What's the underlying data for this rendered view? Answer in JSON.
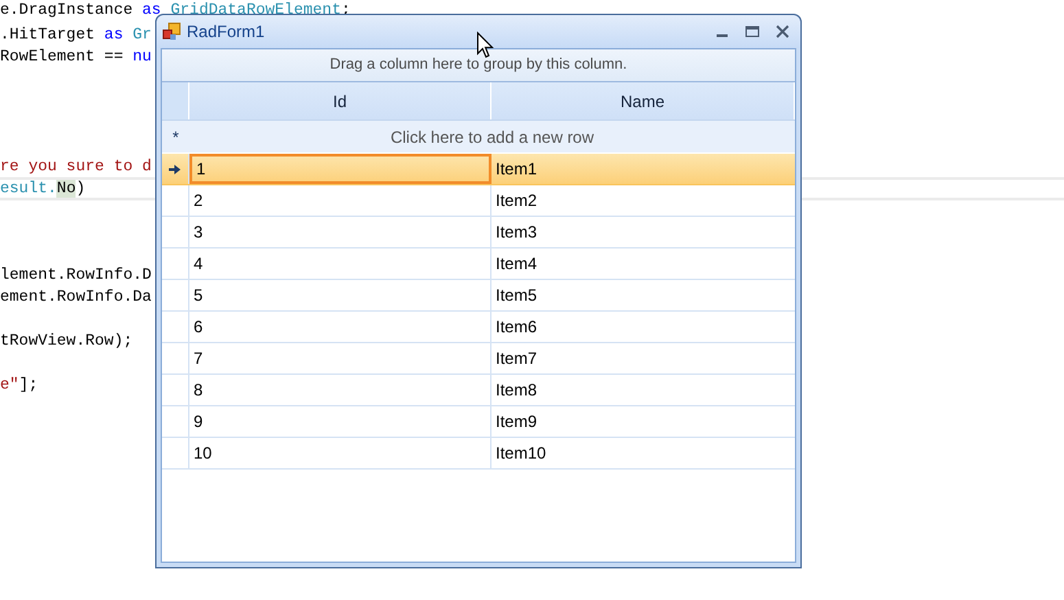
{
  "editor": {
    "lines": [
      {
        "kind": "mixed",
        "parts": [
          {
            "t": "e.DragInstance",
            "kind": "plain"
          },
          {
            "t": " as",
            "kind": "keyword"
          },
          {
            "t": " GridDataRowElement",
            "kind": "type"
          },
          {
            "t": ";",
            "kind": "plain"
          }
        ]
      },
      {
        "kind": "mixed",
        "parts": [
          {
            "t": ".HitTarget",
            "kind": "plain"
          },
          {
            "t": " as",
            "kind": "keyword"
          },
          {
            "t": " Gr",
            "kind": "type"
          }
        ]
      },
      {
        "kind": "mixed",
        "parts": [
          {
            "t": "RowElement ==",
            "kind": "plain"
          },
          {
            "t": " nu",
            "kind": "keyword"
          }
        ]
      },
      {
        "kind": "mixed",
        "parts": [
          {
            "t": "re you sure to d",
            "kind": "string"
          }
        ]
      },
      {
        "kind": "mixed",
        "parts": [
          {
            "t": "esult.",
            "kind": "type"
          },
          {
            "t": "No",
            "kind": "highlight"
          },
          {
            "t": ")",
            "kind": "plain"
          }
        ]
      },
      {
        "kind": "mixed",
        "parts": [
          {
            "t": "lement.RowInfo.D",
            "kind": "plain"
          }
        ]
      },
      {
        "kind": "mixed",
        "parts": [
          {
            "t": "ement.RowInfo.Da",
            "kind": "plain"
          }
        ]
      },
      {
        "kind": "mixed",
        "parts": [
          {
            "t": "tRowView.Row);",
            "kind": "plain"
          }
        ]
      },
      {
        "kind": "mixed",
        "parts": [
          {
            "t": "e\"",
            "kind": "string"
          },
          {
            "t": "];",
            "kind": "plain"
          }
        ]
      }
    ]
  },
  "window": {
    "title": "RadForm1",
    "group_panel": "Drag a column here to group by this column.",
    "columns": [
      "Id",
      "Name"
    ],
    "new_row": "Click here to add a new row",
    "new_row_marker": "*",
    "rows": [
      {
        "id": "1",
        "name": "Item1",
        "selected": true
      },
      {
        "id": "2",
        "name": "Item2",
        "selected": false
      },
      {
        "id": "3",
        "name": "Item3",
        "selected": false
      },
      {
        "id": "4",
        "name": "Item4",
        "selected": false
      },
      {
        "id": "5",
        "name": "Item5",
        "selected": false
      },
      {
        "id": "6",
        "name": "Item6",
        "selected": false
      },
      {
        "id": "7",
        "name": "Item7",
        "selected": false
      },
      {
        "id": "8",
        "name": "Item8",
        "selected": false
      },
      {
        "id": "9",
        "name": "Item9",
        "selected": false
      },
      {
        "id": "10",
        "name": "Item10",
        "selected": false
      }
    ]
  }
}
